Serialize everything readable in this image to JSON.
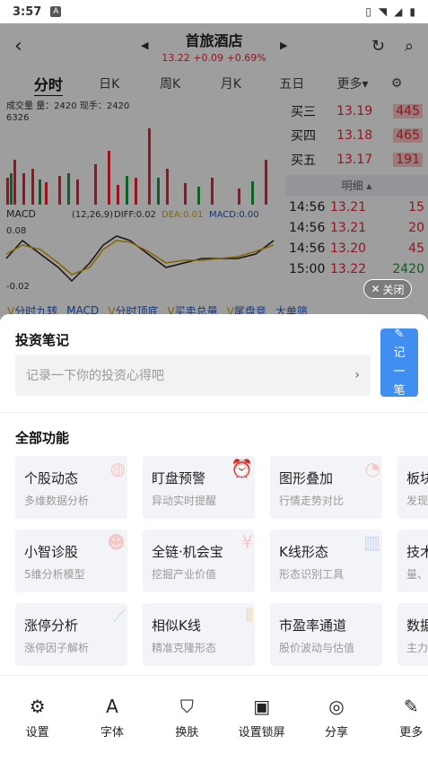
{
  "status": {
    "time": "3:57",
    "badge": "A"
  },
  "stock": {
    "name": "首旅酒店",
    "price": "13.22",
    "change": "+0.09",
    "pct": "+0.69%"
  },
  "tabs": [
    "分时",
    "日K",
    "周K",
    "月K",
    "五日",
    "更多"
  ],
  "chart": {
    "vol_label": "成交量",
    "vol_val": "量：2420",
    "now_hand": "现手：2420",
    "vol_top": "6326",
    "macd_label": "MACD",
    "macd_params": "(12,26,9)",
    "diff": "DIFF:0.02",
    "dea": "DEA:0.01",
    "macd_val": "MACD:0.00",
    "axis_top": "0.08",
    "axis_bottom": "-0.02"
  },
  "orderbook": [
    {
      "label": "买三",
      "price": "13.19",
      "vol": "445"
    },
    {
      "label": "买四",
      "price": "13.18",
      "vol": "465"
    },
    {
      "label": "买五",
      "price": "13.17",
      "vol": "191"
    }
  ],
  "mingxi": "明细",
  "trades": [
    {
      "time": "14:56",
      "price": "13.21",
      "vol": "15"
    },
    {
      "time": "14:56",
      "price": "13.21",
      "vol": "20"
    },
    {
      "time": "14:56",
      "price": "13.20",
      "vol": "45"
    },
    {
      "time": "15:00",
      "price": "13.22",
      "vol": "2420"
    }
  ],
  "indicators": [
    "分时九转",
    "MACD",
    "分时顶底",
    "买卖总量",
    "尾盘竞",
    "大单筛"
  ],
  "close_label": "关闭",
  "notes": {
    "title": "投资笔记",
    "placeholder": "记录一下你的投资心得吧",
    "write_label": [
      "记",
      "一",
      "笔"
    ]
  },
  "all_title": "全部功能",
  "features": [
    {
      "title": "个股动态",
      "sub": "多维数据分析"
    },
    {
      "title": "盯盘预警",
      "sub": "异动实时提醒"
    },
    {
      "title": "图形叠加",
      "sub": "行情走势对比"
    },
    {
      "title": "板块",
      "sub": "发现"
    },
    {
      "title": "小智诊股",
      "sub": "5维分析模型"
    },
    {
      "title": "全链·机会宝",
      "sub": "挖掘产业价值"
    },
    {
      "title": "K线形态",
      "sub": "形态识别工具"
    },
    {
      "title": "技术",
      "sub": "量、"
    },
    {
      "title": "涨停分析",
      "sub": "涨停因子解析"
    },
    {
      "title": "相似K线",
      "sub": "精准克隆形态"
    },
    {
      "title": "市盈率通道",
      "sub": "股价波动与估值"
    },
    {
      "title": "数据",
      "sub": "主力"
    }
  ],
  "bottom": [
    "设置",
    "字体",
    "换肤",
    "设置锁屏",
    "分享",
    "更多"
  ]
}
